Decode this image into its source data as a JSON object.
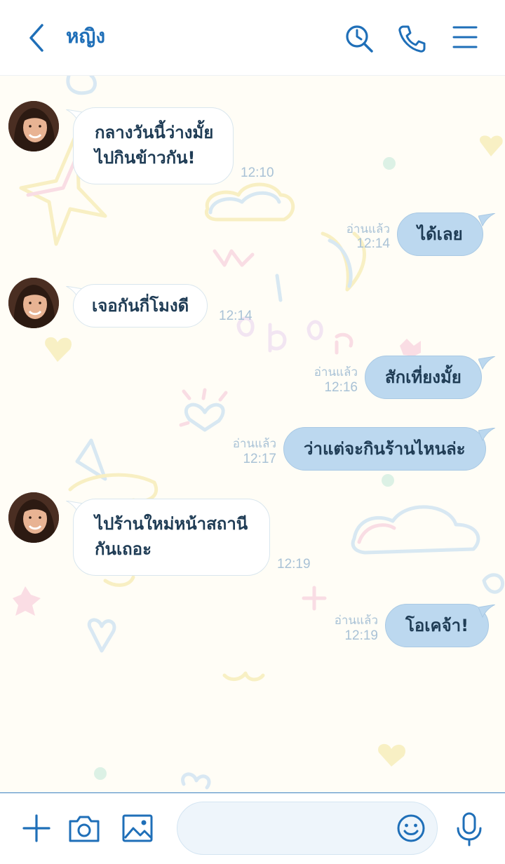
{
  "header": {
    "title": "หญิง",
    "back_icon": "chevron-left-icon",
    "search_icon": "search-history-icon",
    "call_icon": "phone-icon",
    "menu_icon": "menu-icon"
  },
  "messages": [
    {
      "side": "in",
      "text_lines": [
        "กลางวันนี้ว่างมั้ย",
        "ไปกินข้าวกัน!"
      ],
      "time": "12:10"
    },
    {
      "side": "out",
      "text": "ได้เลย",
      "read": "อ่านแล้ว",
      "time": "12:14"
    },
    {
      "side": "in",
      "text": "เจอกันกี่โมงดี",
      "time": "12:14"
    },
    {
      "side": "out",
      "text": "สักเที่ยงมั้ย",
      "read": "อ่านแล้ว",
      "time": "12:16"
    },
    {
      "side": "out",
      "text": "ว่าแต่จะกินร้านไหนล่ะ",
      "read": "อ่านแล้ว",
      "time": "12:17"
    },
    {
      "side": "in",
      "text_lines": [
        "ไปร้านใหม่หน้าสถานี",
        "กันเถอะ"
      ],
      "time": "12:19"
    },
    {
      "side": "out",
      "text": "โอเคจ้า!",
      "read": "อ่านแล้ว",
      "time": "12:19"
    }
  ],
  "footer": {
    "add_icon": "plus-icon",
    "camera_icon": "camera-icon",
    "image_icon": "image-icon",
    "input_placeholder": "",
    "emoji_icon": "emoji-icon",
    "mic_icon": "microphone-icon"
  },
  "colors": {
    "accent": "#1f6fb8",
    "outgoing_bubble": "#bcd8ef",
    "incoming_bubble": "#ffffff",
    "background": "#fffdf6"
  }
}
